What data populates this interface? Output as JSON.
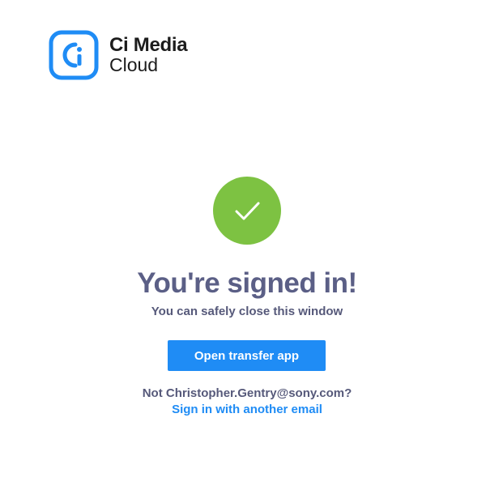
{
  "brand": {
    "name_line1": "Ci Media",
    "name_line2": "Cloud",
    "logo_glyph": "Ci",
    "logo_color": "#1f8cf5"
  },
  "status": {
    "icon": "checkmark-icon",
    "icon_color": "#7dc242",
    "title": "You're signed in!",
    "subtitle": "You can safely close this window"
  },
  "actions": {
    "open_app_label": "Open transfer app",
    "open_app_color": "#1f8cf5",
    "not_user_text": "Not Christopher.Gentry@sony.com?",
    "switch_account_label": "Sign in with another email"
  }
}
